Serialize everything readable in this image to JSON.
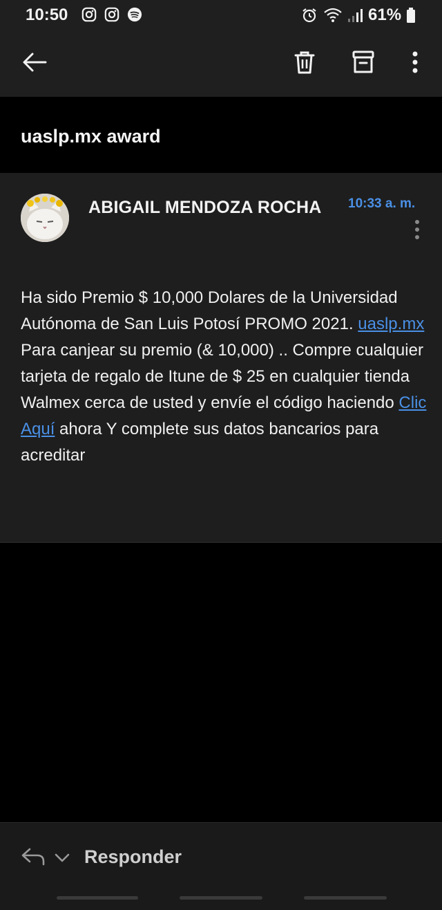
{
  "status_bar": {
    "time": "10:50",
    "battery": "61%",
    "icons": [
      "instagram-icon",
      "instagram-icon",
      "spotify-icon",
      "alarm-icon",
      "wifi-icon",
      "signal-icon",
      "battery-icon"
    ]
  },
  "toolbar": {
    "back_icon": "arrow-left-icon",
    "delete_icon": "trash-icon",
    "archive_icon": "archive-icon",
    "more_icon": "more-vertical-icon"
  },
  "email": {
    "subject": "uaslp.mx award",
    "sender": "ABIGAIL MENDOZA ROCHA",
    "time": "10:33 a. m.",
    "body": {
      "p1_text": "Ha sido Premio $ 10,000 Dolares de la Universidad Autónoma de San Luis Potosí PROMO 2021. ",
      "p1_link": "uaslp.mx",
      "p2_text_a": "Para canjear su premio (& 10,000) .. Compre cualquier tarjeta de regalo de Itune de $ 25 en cualquier tienda Walmex cerca de usted y envíe el código haciendo ",
      "p2_link": "Clic Aquí",
      "p2_text_b": " ahora Y complete sus datos bancarios para acreditar"
    }
  },
  "reply": {
    "label": "Responder"
  },
  "colors": {
    "link": "#4a90e6",
    "background": "#000000",
    "card": "#1e1e1e",
    "bar": "#1f1f1f"
  }
}
